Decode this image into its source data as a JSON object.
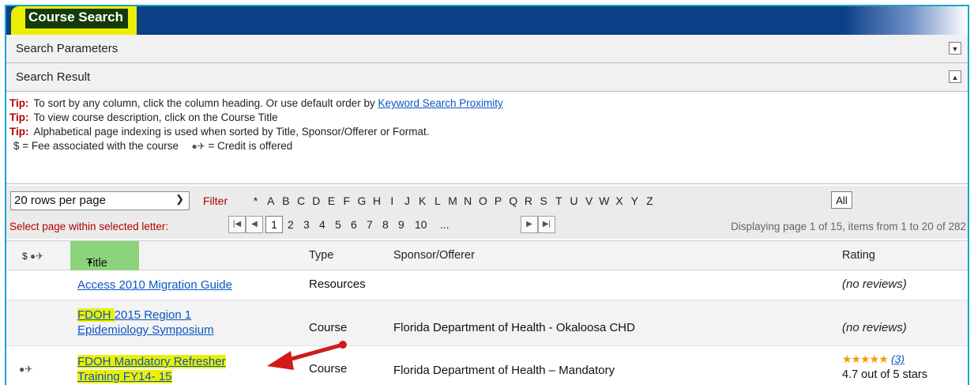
{
  "header": {
    "title": "Course Search"
  },
  "sections": {
    "search_parameters": "Search Parameters",
    "search_result": "Search Result"
  },
  "tips": {
    "label": "Tip:",
    "tip1_text": "To sort by any column, click the column heading. Or use default order by",
    "tip1_link": "Keyword Search Proximity",
    "tip2_text": "To view course description, click on the Course Title",
    "tip3_text": "Alphabetical page indexing is used when sorted by Title, Sponsor/Offerer or Format.",
    "legend_fee": "$ = Fee associated with the course",
    "legend_credit": "= Credit is offered"
  },
  "grid": {
    "rows_per_page": "20 rows per page",
    "filter_label": "Filter",
    "letters": [
      "*",
      "A",
      "B",
      "C",
      "D",
      "E",
      "F",
      "G",
      "H",
      "I",
      "J",
      "K",
      "L",
      "M",
      "N",
      "O",
      "P",
      "Q",
      "R",
      "S",
      "T",
      "U",
      "V",
      "W",
      "X",
      "Y",
      "Z"
    ],
    "all_label": "All",
    "select_page_label": "Select page within selected letter:",
    "current_page": "1",
    "pages": [
      "2",
      "3",
      "4",
      "5",
      "6",
      "7",
      "8",
      "9",
      "10",
      "..."
    ],
    "display_text": "Displaying page 1 of 15, items from 1 to 20 of 282"
  },
  "columns": {
    "fee_credit": "$",
    "title": "Title",
    "sort_indicator": "▲",
    "type": "Type",
    "sponsor": "Sponsor/Offerer",
    "rating": "Rating"
  },
  "rows": [
    {
      "title_line1": "Access 2010 Migration Guide",
      "title_line2": "",
      "type": "Resources",
      "sponsor": "",
      "rating": "(no reviews)",
      "credit": false
    },
    {
      "title_hl1": "FDOH ",
      "title_line1": "2015 Region 1",
      "title_line2": "Epidemiology Symposium",
      "type": "Course",
      "sponsor": "Florida Department of Health - Okaloosa CHD",
      "rating": "(no reviews)",
      "credit": false
    },
    {
      "title_line1": "FDOH Mandatory Refresher",
      "title_line2": "Training FY14- 15",
      "type": "Course",
      "sponsor": "Florida Department of Health – Mandatory",
      "stars": "★★★★★",
      "review_count": "(3)",
      "rating_text": "4.7 out of 5 stars",
      "credit": true
    }
  ],
  "colors": {
    "title_bar": "#0b3f86",
    "highlight": "#ecf000",
    "frame_border": "#19a6c6",
    "sorted_column": "#8bd37d",
    "tip_red": "#b30000",
    "arrow": "#d11a1a"
  }
}
